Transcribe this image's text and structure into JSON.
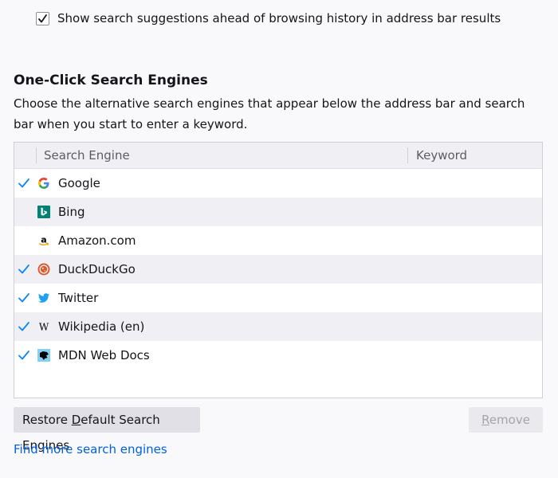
{
  "top_option": {
    "checked": true,
    "label": "Show search suggestions ahead of browsing history in address bar results"
  },
  "section": {
    "title": "One-Click Search Engines",
    "description": "Choose the alternative search engines that appear below the address bar and search bar when you start to enter a keyword."
  },
  "table": {
    "columns": [
      "Search Engine",
      "Keyword"
    ],
    "rows": [
      {
        "name": "Google",
        "enabled": true,
        "icon": "google-icon",
        "keyword": ""
      },
      {
        "name": "Bing",
        "enabled": false,
        "icon": "bing-icon",
        "keyword": ""
      },
      {
        "name": "Amazon.com",
        "enabled": false,
        "icon": "amazon-icon",
        "keyword": ""
      },
      {
        "name": "DuckDuckGo",
        "enabled": true,
        "icon": "duckduckgo-icon",
        "keyword": ""
      },
      {
        "name": "Twitter",
        "enabled": true,
        "icon": "twitter-icon",
        "keyword": ""
      },
      {
        "name": "Wikipedia (en)",
        "enabled": true,
        "icon": "wikipedia-icon",
        "keyword": ""
      },
      {
        "name": "MDN Web Docs",
        "enabled": true,
        "icon": "mdn-icon",
        "keyword": ""
      }
    ]
  },
  "buttons": {
    "restore_prefix": "Restore ",
    "restore_accesskey": "D",
    "restore_suffix": "efault Search Engines",
    "remove_accesskey": "R",
    "remove_suffix": "emove"
  },
  "links": {
    "find_more": "Find more search engines"
  },
  "colors": {
    "accent": "#0061e0",
    "check": "#0a84ff"
  }
}
